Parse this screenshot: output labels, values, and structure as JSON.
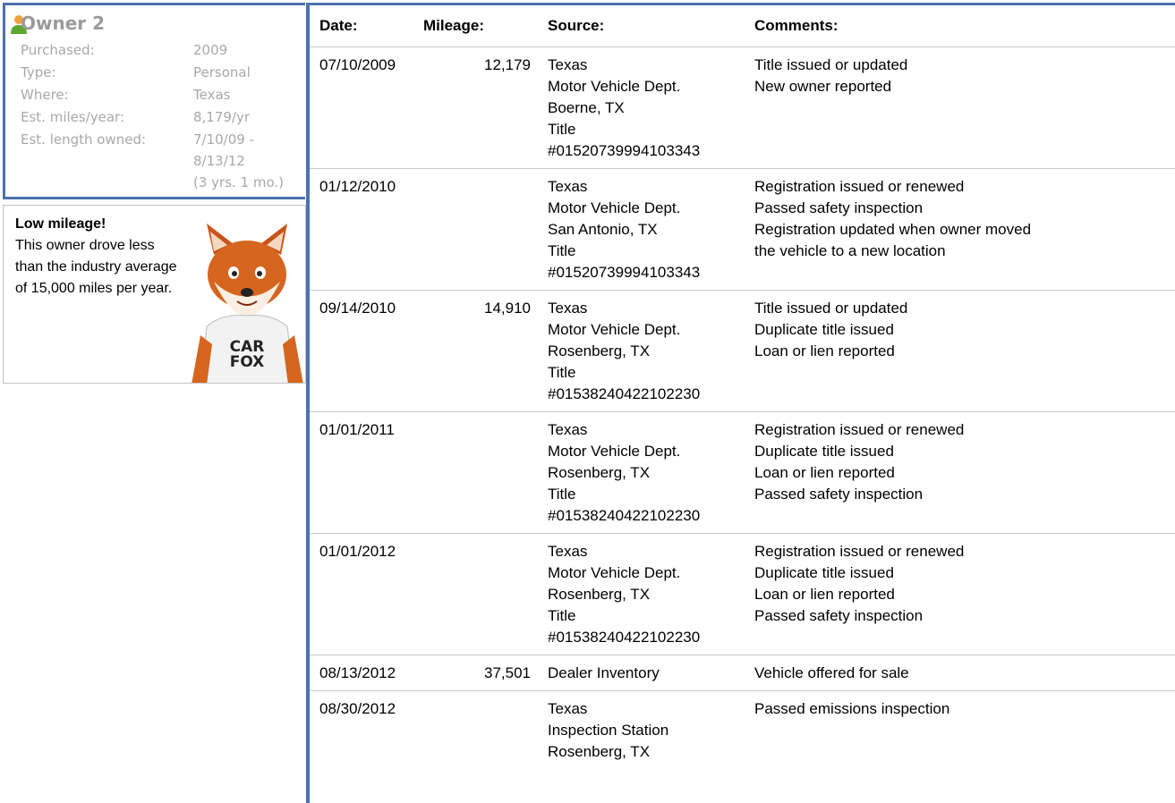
{
  "owner": {
    "title": "Owner 2",
    "fields": [
      {
        "label": "Purchased:",
        "value": "2009"
      },
      {
        "label": "Type:",
        "value": "Personal"
      },
      {
        "label": "Where:",
        "value": "Texas"
      },
      {
        "label": "Est. miles/year:",
        "value": "8,179/yr"
      },
      {
        "label": "Est. length owned:",
        "value": "7/10/09 -\n8/13/12\n(3 yrs. 1 mo.)"
      }
    ]
  },
  "mileage_note": {
    "title": "Low mileage!",
    "text": "This owner drove less than the industry average of 15,000 miles per year.",
    "mascot_shirt": "CAR FOX"
  },
  "table": {
    "headers": [
      "Date:",
      "Mileage:",
      "Source:",
      "Comments:"
    ],
    "rows": [
      {
        "date": "07/10/2009",
        "mileage": "12,179",
        "source": [
          "Texas",
          "Motor Vehicle Dept.",
          "Boerne, TX",
          "Title",
          "#01520739994103343"
        ],
        "comments": [
          "Title issued or updated",
          "New owner reported"
        ]
      },
      {
        "date": "01/12/2010",
        "mileage": "",
        "source": [
          "Texas",
          "Motor Vehicle Dept.",
          "San Antonio, TX",
          "Title",
          "#01520739994103343"
        ],
        "comments": [
          "Registration issued or renewed",
          "Passed safety inspection",
          "Registration updated when owner moved",
          "the vehicle to a new location"
        ]
      },
      {
        "date": "09/14/2010",
        "mileage": "14,910",
        "source": [
          "Texas",
          "Motor Vehicle Dept.",
          "Rosenberg, TX",
          "Title",
          "#01538240422102230"
        ],
        "comments": [
          "Title issued or updated",
          "Duplicate title issued",
          "Loan or lien reported"
        ]
      },
      {
        "date": "01/01/2011",
        "mileage": "",
        "source": [
          "Texas",
          "Motor Vehicle Dept.",
          "Rosenberg, TX",
          "Title",
          "#01538240422102230"
        ],
        "comments": [
          "Registration issued or renewed",
          "Duplicate title issued",
          "Loan or lien reported",
          "Passed safety inspection"
        ]
      },
      {
        "date": "01/01/2012",
        "mileage": "",
        "source": [
          "Texas",
          "Motor Vehicle Dept.",
          "Rosenberg, TX",
          "Title",
          "#01538240422102230"
        ],
        "comments": [
          "Registration issued or renewed",
          "Duplicate title issued",
          "Loan or lien reported",
          "Passed safety inspection"
        ]
      },
      {
        "date": "08/13/2012",
        "mileage": "37,501",
        "source": [
          "Dealer Inventory"
        ],
        "comments": [
          "Vehicle offered for sale"
        ]
      },
      {
        "date": "08/30/2012",
        "mileage": "",
        "source": [
          "Texas",
          "Inspection Station",
          "Rosenberg, TX"
        ],
        "comments": [
          "Passed emissions inspection"
        ]
      }
    ]
  },
  "colors": {
    "accent_border": "#4a74ac",
    "muted_text": "#a8a8a8",
    "row_border": "#c8c8c8",
    "icon_green": "#5ca82e",
    "icon_orange": "#f0a040"
  }
}
